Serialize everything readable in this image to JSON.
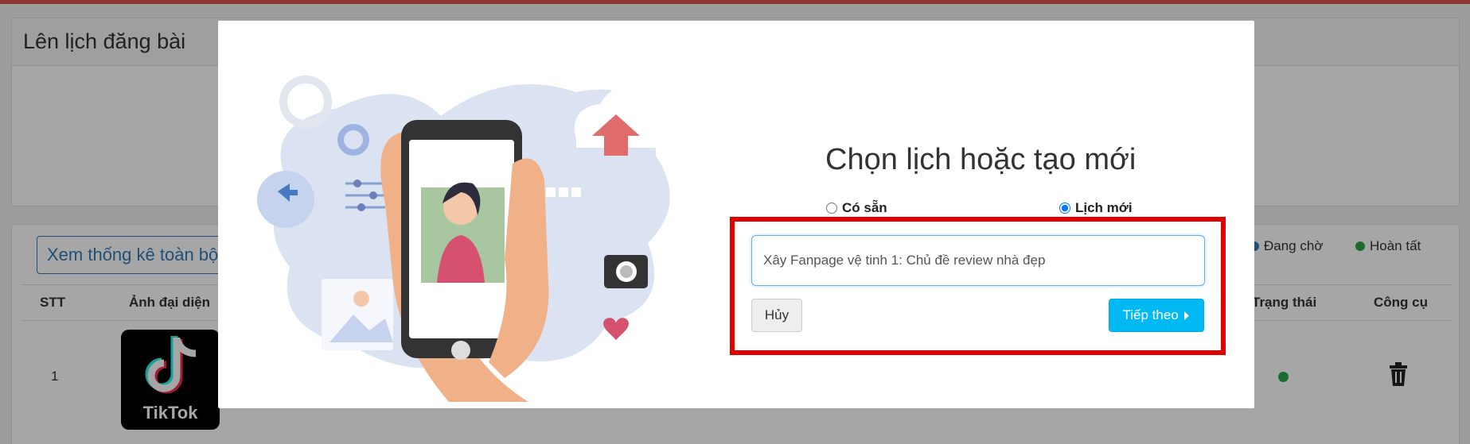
{
  "page": {
    "header_title": "Lên lịch đăng bài",
    "stats_button": "Xem thống kê toàn bộ"
  },
  "legend": [
    {
      "label": "Đang chờ",
      "color": "#337ab7"
    },
    {
      "label": "Hoàn tất",
      "color": "#28a745"
    }
  ],
  "table": {
    "headers": {
      "stt": "STT",
      "avatar": "Ảnh đại diện",
      "status": "Trạng thái",
      "tools": "Công cụ"
    },
    "rows": [
      {
        "stt": "1",
        "avatar_text": "TikTok",
        "status_color": "#28a745"
      }
    ]
  },
  "modal": {
    "title": "Chọn lịch hoặc tạo mới",
    "radio_existing": "Có sẵn",
    "radio_new": "Lịch mới",
    "selected": "new",
    "input_value": "Xây Fanpage vệ tinh 1: Chủ đề review nhà đẹp",
    "cancel_label": "Hủy",
    "next_label": "Tiếp theo"
  },
  "icons": {
    "trash": "trash-icon",
    "caret": "caret-right-icon"
  }
}
